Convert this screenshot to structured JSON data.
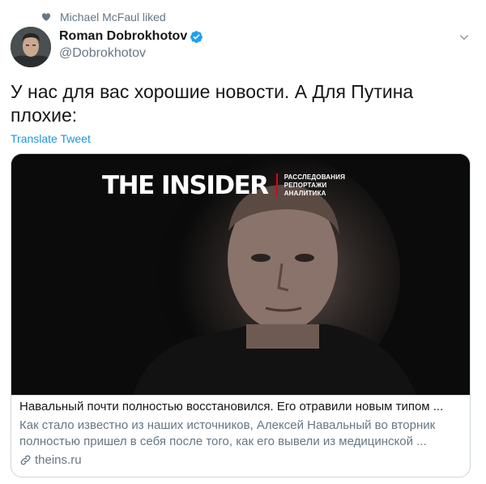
{
  "social_context": {
    "text": "Michael McFaul liked",
    "icon": "heart-icon"
  },
  "author": {
    "display_name": "Roman Dobrokhotov",
    "handle": "@Dobrokhotov",
    "verified": true,
    "verified_color": "#1da1f2"
  },
  "tweet": {
    "text": "У нас для вас хорошие новости. А Для Путина плохие:",
    "translate_label": "Translate Tweet"
  },
  "card": {
    "brand_title": "THE INSIDER",
    "brand_tags": [
      "РАССЛЕДОВАНИЯ",
      "РЕПОРТАЖИ",
      "АНАЛИТИКА"
    ],
    "brand_accent": "#e2001a",
    "title": "Навальный почти полностью восстановился. Его отравили новым типом ...",
    "description": "Как стало известно из наших источников, Алексей Навальный во вторник полностью пришел в себя после того, как его вывели из медицинской ...",
    "domain": "theins.ru",
    "link_icon": "link-icon"
  },
  "colors": {
    "link": "#1b95e0",
    "secondary_text": "#657786",
    "border": "#ccd6dd"
  }
}
